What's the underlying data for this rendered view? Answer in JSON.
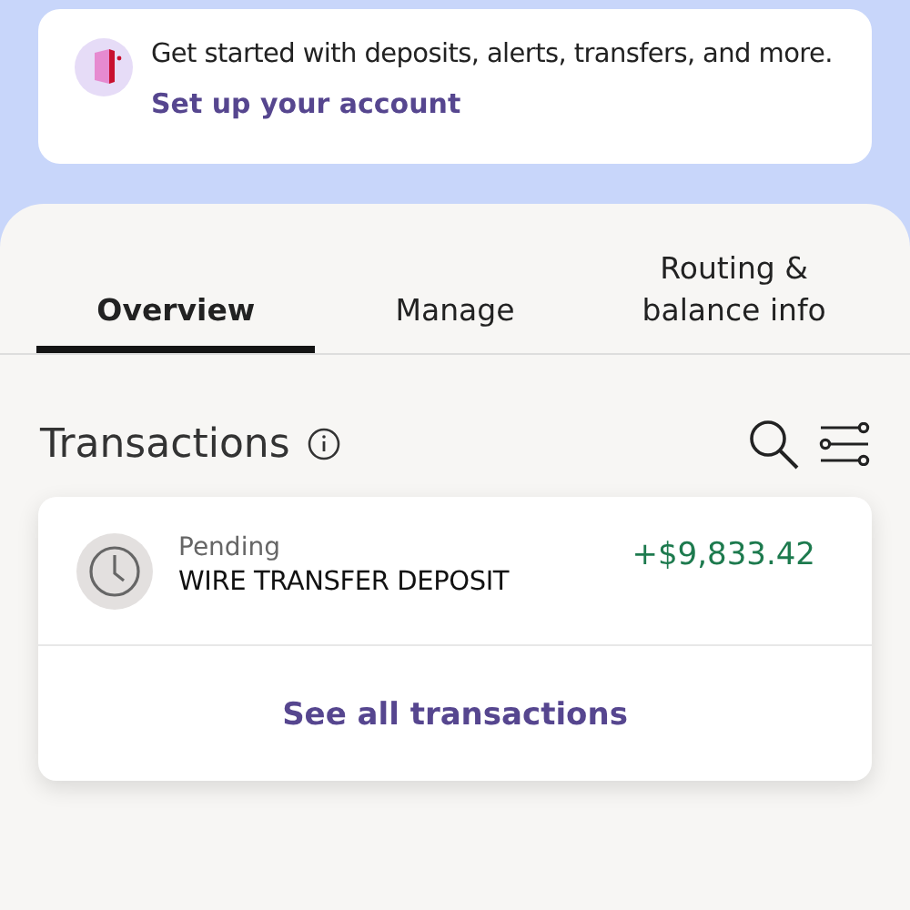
{
  "banner": {
    "message": "Get started with deposits, alerts, transfers, and more.",
    "link": "Set up your account"
  },
  "tabs": [
    {
      "label": "Overview",
      "selected": true
    },
    {
      "label": "Manage",
      "selected": false
    },
    {
      "label": "Routing &\nbalance info",
      "selected": false
    }
  ],
  "transactions": {
    "title": "Transactions",
    "items": [
      {
        "status": "Pending",
        "description": "WIRE TRANSFER DEPOSIT",
        "amount": "+$9,833.42"
      }
    ],
    "see_all": "See all transactions"
  }
}
